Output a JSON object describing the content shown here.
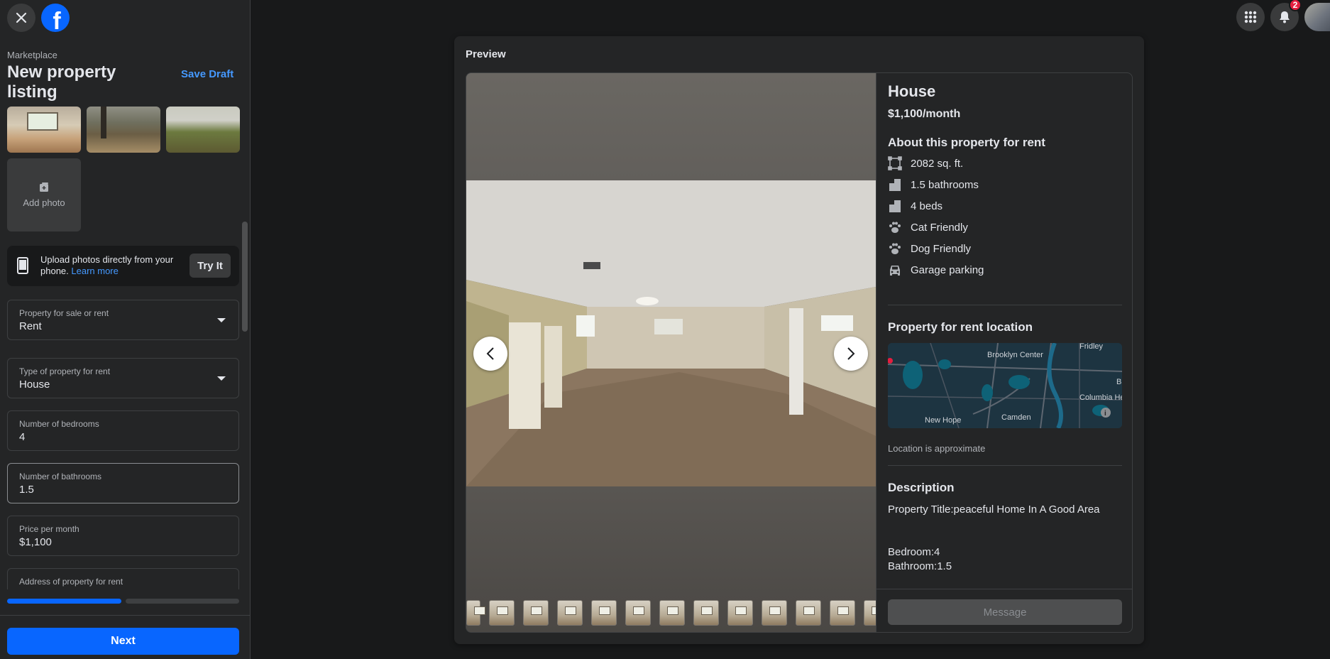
{
  "sidebar": {
    "breadcrumb": "Marketplace",
    "title": "New property listing",
    "save_draft": "Save Draft",
    "add_photo": "Add photo",
    "upload_card": {
      "text": "Upload photos directly from your phone.",
      "link": "Learn more",
      "button": "Try It"
    },
    "fields": [
      {
        "label": "Property for sale or rent",
        "value": "Rent"
      },
      {
        "label": "Type of property for rent",
        "value": "House"
      },
      {
        "label": "Number of bedrooms",
        "value": "4"
      },
      {
        "label": "Number of bathrooms",
        "value": "1.5"
      },
      {
        "label": "Price per month",
        "value": "$1,100"
      },
      {
        "label": "Address of property for rent",
        "value": ""
      }
    ],
    "progress": {
      "steps": 2,
      "completed": 1
    },
    "next_button": "Next"
  },
  "topbar": {
    "notification_count": "2",
    "icons": [
      "menu-grid-icon",
      "bell-icon",
      "avatar"
    ]
  },
  "preview": {
    "title": "Preview",
    "listing": {
      "title": "House",
      "price": "$1,100/month",
      "about_heading": "About this property for rent",
      "attributes": [
        {
          "icon": "area-icon",
          "text": "2082 sq. ft."
        },
        {
          "icon": "building-icon",
          "text": "1.5 bathrooms"
        },
        {
          "icon": "building-icon",
          "text": "4 beds"
        },
        {
          "icon": "paw-icon",
          "text": "Cat Friendly"
        },
        {
          "icon": "paw-icon",
          "text": "Dog Friendly"
        },
        {
          "icon": "car-icon",
          "text": "Garage parking"
        }
      ],
      "location_heading": "Property for rent location",
      "map_labels": [
        "Brooklyn Center",
        "Fridley",
        "Columbia Heights",
        "New Hope",
        "Camden",
        "B"
      ],
      "location_note": "Location is approximate",
      "description_heading": "Description",
      "description_line1": "Property Title:peaceful Home In A Good Area",
      "description_line2": "Bedroom:4",
      "description_line3": "Bathroom:1.5",
      "message_button": "Message"
    }
  },
  "colors": {
    "accent": "#0866ff",
    "link": "#4599ff",
    "background": "#18191a",
    "panel": "#242526"
  }
}
